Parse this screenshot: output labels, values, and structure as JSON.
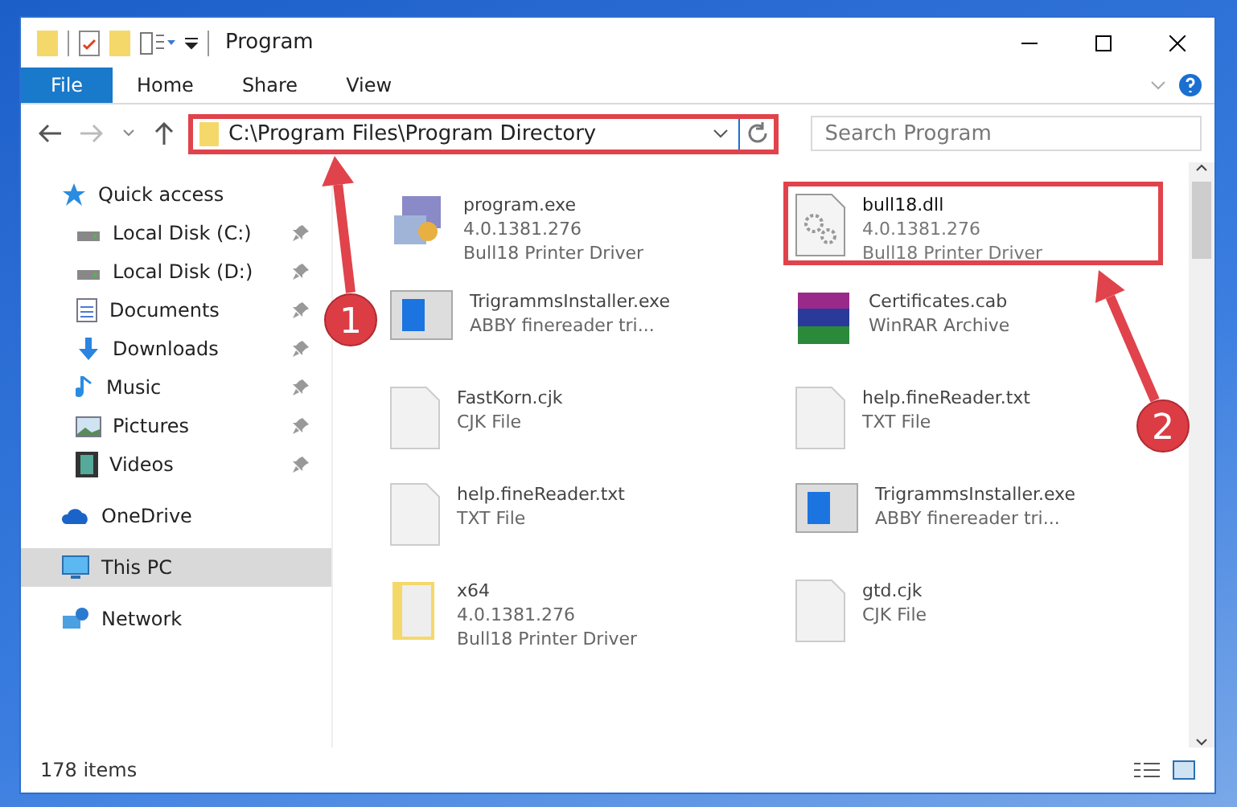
{
  "window": {
    "title": "Program"
  },
  "ribbon_tabs": [
    {
      "label": "File",
      "selected": true
    },
    {
      "label": "Home",
      "selected": false
    },
    {
      "label": "Share",
      "selected": false
    },
    {
      "label": "View",
      "selected": false
    }
  ],
  "address": {
    "path": "C:\\Program Files\\Program Directory",
    "highlighted": true
  },
  "search": {
    "placeholder": "Search Program"
  },
  "sidebar": {
    "items": [
      {
        "label": "Quick access",
        "kind": "star",
        "pinned": false,
        "selected": false,
        "children": [
          {
            "label": "Local Disk (C:)",
            "kind": "disk",
            "pinned": true,
            "selected": false
          },
          {
            "label": "Local Disk (D:)",
            "kind": "disk",
            "pinned": true,
            "selected": false
          },
          {
            "label": "Documents",
            "kind": "doc",
            "pinned": true,
            "selected": false
          },
          {
            "label": "Downloads",
            "kind": "down",
            "pinned": true,
            "selected": false
          },
          {
            "label": "Music",
            "kind": "music",
            "pinned": true,
            "selected": false
          },
          {
            "label": "Pictures",
            "kind": "pics",
            "pinned": true,
            "selected": false
          },
          {
            "label": "Videos",
            "kind": "video",
            "pinned": true,
            "selected": false
          }
        ]
      },
      {
        "label": "OneDrive",
        "kind": "cloud",
        "pinned": false,
        "selected": false
      },
      {
        "label": "This PC",
        "kind": "pc",
        "pinned": false,
        "selected": true
      },
      {
        "label": "Network",
        "kind": "net",
        "pinned": false,
        "selected": false
      }
    ]
  },
  "files": [
    {
      "name": "program.exe",
      "lines": [
        "4.0.1381.276",
        "Bull18 Printer Driver"
      ],
      "kind": "app",
      "highlighted": false
    },
    {
      "name": "bull18.dll",
      "lines": [
        "4.0.1381.276",
        "Bull18 Printer Driver"
      ],
      "kind": "gear",
      "highlighted": true
    },
    {
      "name": "TrigrammsInstaller.exe",
      "lines": [
        "ABBY finereader tri..."
      ],
      "kind": "window",
      "highlighted": false
    },
    {
      "name": "Certificates.cab",
      "lines": [
        "WinRAR Archive"
      ],
      "kind": "rar",
      "highlighted": false
    },
    {
      "name": "FastKorn.cjk",
      "lines": [
        "CJK File"
      ],
      "kind": "file",
      "highlighted": false
    },
    {
      "name": "help.fineReader.txt",
      "lines": [
        "TXT File"
      ],
      "kind": "file",
      "highlighted": false
    },
    {
      "name": "help.fineReader.txt",
      "lines": [
        "TXT File"
      ],
      "kind": "file",
      "highlighted": false
    },
    {
      "name": "TrigrammsInstaller.exe",
      "lines": [
        "ABBY finereader tri..."
      ],
      "kind": "window",
      "highlighted": false
    },
    {
      "name": "x64",
      "lines": [
        "4.0.1381.276",
        "Bull18 Printer Driver"
      ],
      "kind": "folder",
      "highlighted": false
    },
    {
      "name": "gtd.cjk",
      "lines": [
        "CJK File"
      ],
      "kind": "file",
      "highlighted": false
    }
  ],
  "status_bar": {
    "count": "178 items"
  },
  "annotations": [
    {
      "label": "1"
    },
    {
      "label": "2"
    }
  ]
}
